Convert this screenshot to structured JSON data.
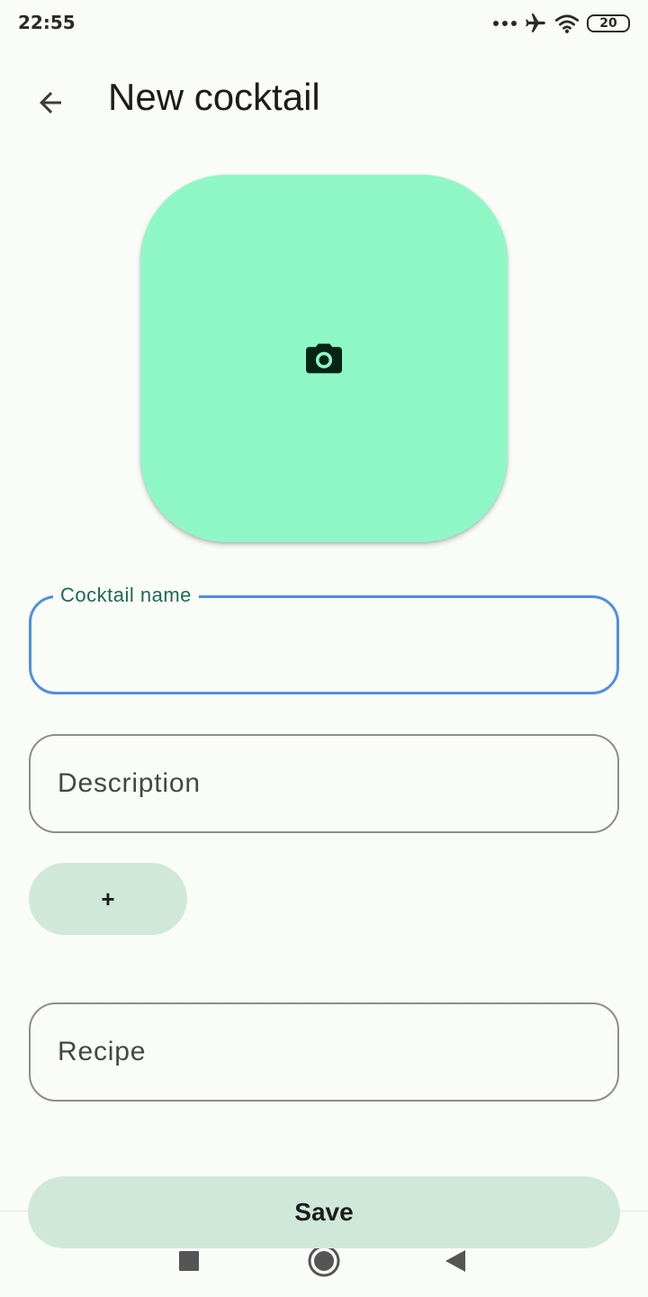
{
  "status_bar": {
    "time": "22:55",
    "battery": "20",
    "icons": [
      "more-dots-icon",
      "airplane-mode-icon",
      "wifi-icon",
      "battery-icon"
    ]
  },
  "header": {
    "title": "New cocktail",
    "back_icon": "arrow-back-icon"
  },
  "photo": {
    "icon": "camera-icon",
    "background_color": "#8ff7c6"
  },
  "form": {
    "name_label": "Cocktail name",
    "name_value": "",
    "description_placeholder": "Description",
    "add_label": "+",
    "recipe_placeholder": "Recipe",
    "save_label": "Save"
  },
  "colors": {
    "accent": "#1d6a52",
    "focus_border": "#4f8fe0",
    "button_tonal": "#cfe8da"
  },
  "nav_bar": {
    "icons": [
      "recents-square-icon",
      "home-circle-icon",
      "back-triangle-icon"
    ]
  }
}
